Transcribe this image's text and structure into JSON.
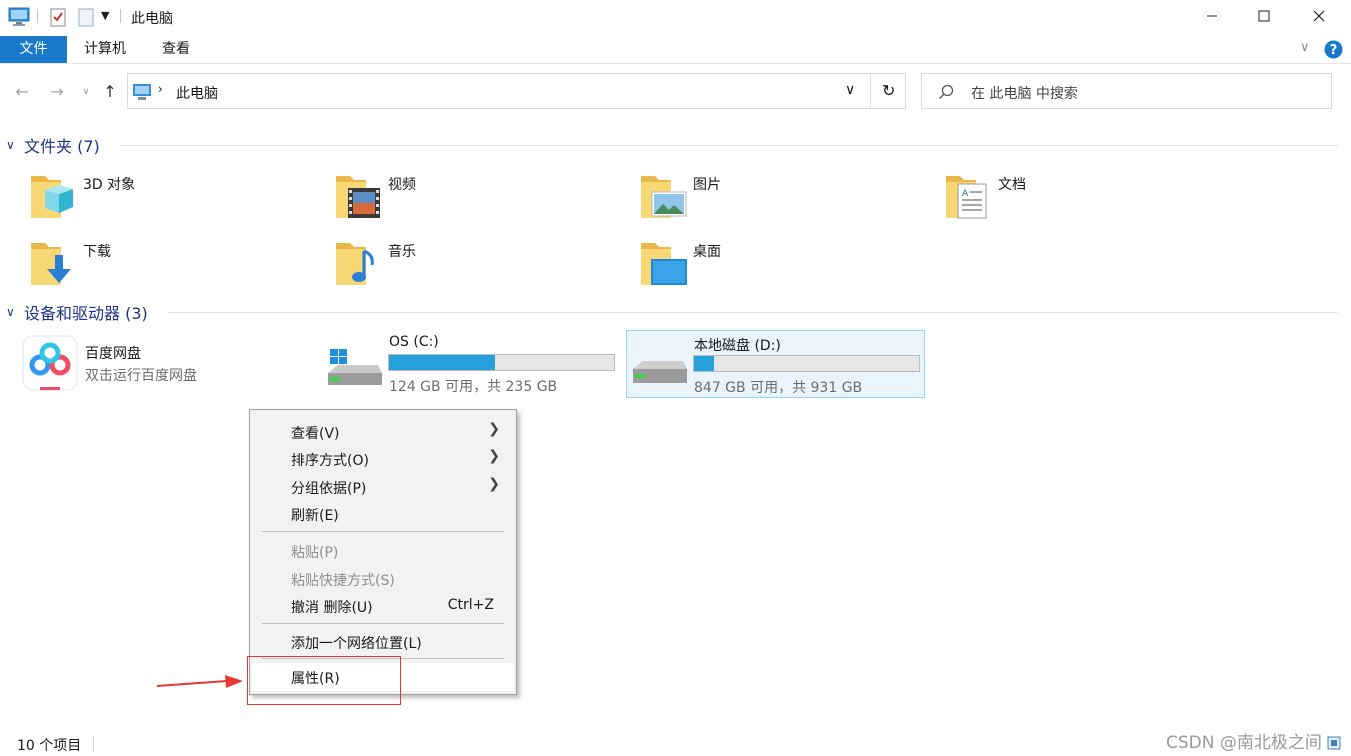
{
  "window": {
    "title": "此电脑",
    "minimize": "—",
    "maximize": "☐",
    "close": "✕"
  },
  "ribbon": {
    "tabs": [
      "文件",
      "计算机",
      "查看"
    ]
  },
  "address": {
    "path": "此电脑",
    "search_placeholder": "在 此电脑 中搜索"
  },
  "folders_section": {
    "title": "文件夹 (7)",
    "items": [
      "3D 对象",
      "视频",
      "图片",
      "文档",
      "下载",
      "音乐",
      "桌面"
    ]
  },
  "devices_section": {
    "title": "设备和驱动器 (3)",
    "baidu": {
      "name": "百度网盘",
      "subtitle": "双击运行百度网盘"
    },
    "drives": [
      {
        "name": "OS (C:)",
        "info": "124 GB 可用，共 235 GB",
        "used_fraction": 0.47
      },
      {
        "name": "本地磁盘 (D:)",
        "info": "847 GB 可用，共 931 GB",
        "used_fraction": 0.09
      }
    ]
  },
  "context_menu": {
    "items": [
      {
        "label": "查看(V)"
      },
      {
        "label": "排序方式(O)"
      },
      {
        "label": "分组依据(P)"
      },
      {
        "label": "刷新(E)"
      },
      {
        "label": "粘贴(P)"
      },
      {
        "label": "粘贴快捷方式(S)"
      },
      {
        "label": "撤消 删除(U)",
        "shortcut": "Ctrl+Z"
      },
      {
        "label": "添加一个网络位置(L)"
      },
      {
        "label": "属性(R)"
      }
    ]
  },
  "status": {
    "count": "10 个项目"
  },
  "watermark": "CSDN @南北极之间",
  "colors": {
    "accent": "#1979ca",
    "section_header": "#1e3287",
    "drive_fill": "#26a0da",
    "annotation": "#e53935"
  }
}
